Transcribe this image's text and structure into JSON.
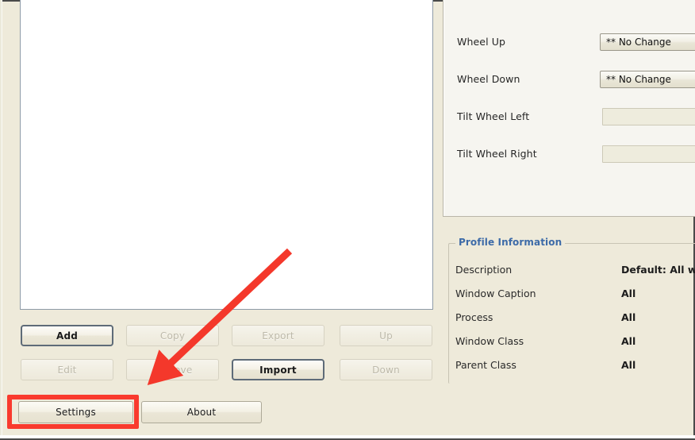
{
  "window": {
    "background_color": "#EEEADA",
    "panel_color": "#F6F5F0"
  },
  "list_panel": {
    "name": "profiles-list",
    "items": [],
    "empty": true
  },
  "buttons": {
    "add": {
      "label": "Add",
      "enabled": true,
      "default": true
    },
    "copy": {
      "label": "Copy",
      "enabled": false
    },
    "export": {
      "label": "Export",
      "enabled": false
    },
    "up": {
      "label": "Up",
      "enabled": false
    },
    "edit": {
      "label": "Edit",
      "enabled": false
    },
    "remove": {
      "label": "Remove",
      "enabled": false
    },
    "import": {
      "label": "Import",
      "enabled": true,
      "default": true
    },
    "down": {
      "label": "Down",
      "enabled": false
    },
    "settings": {
      "label": "Settings",
      "enabled": true
    },
    "about": {
      "label": "About",
      "enabled": true
    }
  },
  "mappings": {
    "rows": [
      {
        "label": "Wheel Up",
        "value": "** No Change",
        "type": "combo"
      },
      {
        "label": "Wheel Down",
        "value": "** No Change",
        "type": "combo"
      },
      {
        "label": "Tilt Wheel Left",
        "value": "",
        "type": "text"
      },
      {
        "label": "Tilt Wheel Right",
        "value": "",
        "type": "text"
      }
    ]
  },
  "profile_information": {
    "title": "Profile Information",
    "title_color": "#3D6BA8",
    "rows": [
      {
        "label": "Description",
        "value": "Default: All w"
      },
      {
        "label": "Window Caption",
        "value": "All"
      },
      {
        "label": "Process",
        "value": "All"
      },
      {
        "label": "Window Class",
        "value": "All"
      },
      {
        "label": "Parent Class",
        "value": "All"
      }
    ]
  },
  "annotations": {
    "highlight_color": "#F93A2E",
    "rectangle_target": "Settings",
    "arrow_target": "Remove"
  }
}
